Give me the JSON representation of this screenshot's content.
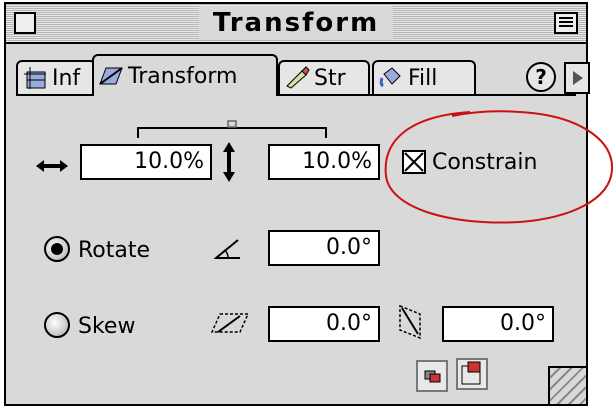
{
  "window": {
    "title": "Transform"
  },
  "tabs": [
    {
      "label": "Inf",
      "icon": "info-icon"
    },
    {
      "label": "Transform",
      "icon": "transform-icon"
    },
    {
      "label": "Str",
      "icon": "stroke-icon"
    },
    {
      "label": "Fill",
      "icon": "fill-icon"
    }
  ],
  "help": {
    "label": "?"
  },
  "scale": {
    "width_value": "10.0%",
    "height_value": "10.0%",
    "constrain_label": "Constrain",
    "constrain_checked": true
  },
  "rotate": {
    "label": "Rotate",
    "selected": true,
    "angle_value": "0.0°"
  },
  "skew": {
    "label": "Skew",
    "selected": false,
    "h_value": "0.0°",
    "v_value": "0.0°"
  },
  "colors": {
    "annotation": "#cc1111",
    "panel": "#d9d9d9"
  }
}
